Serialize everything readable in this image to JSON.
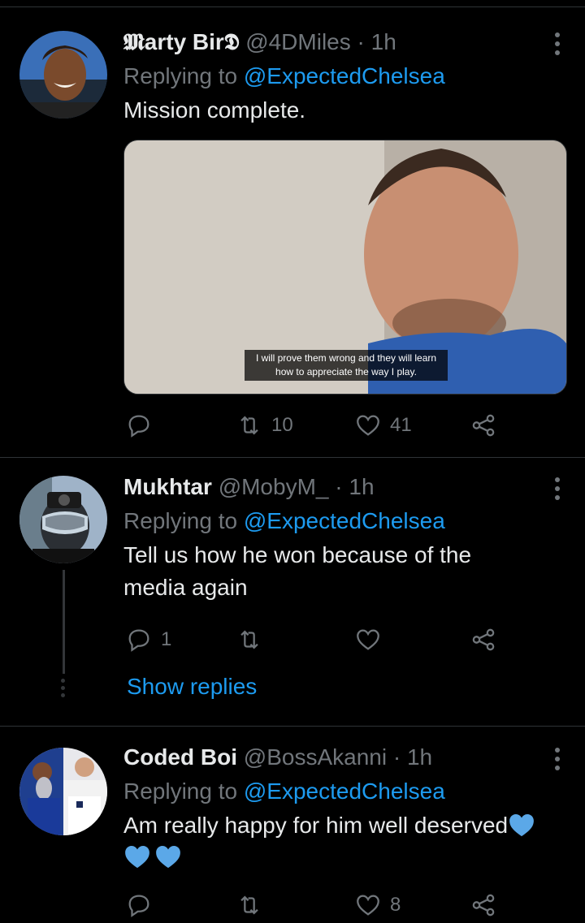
{
  "tweets": [
    {
      "name": "𝕸arty Bir𝕯",
      "handle": "@4DMiles",
      "dot": "·",
      "time": "1h",
      "replying_to_label": "Replying to",
      "replying_to": "@ExpectedChelsea",
      "text": "Mission complete.",
      "media_caption": "I will prove them wrong and they will learn how to appreciate the way I play.",
      "reply_count": "",
      "retweet_count": "10",
      "like_count": "41"
    },
    {
      "name": "Mukhtar",
      "handle": "@MobyM_",
      "dot": "·",
      "time": "1h",
      "replying_to_label": "Replying to",
      "replying_to": "@ExpectedChelsea",
      "text": "Tell us how he won because of the media again",
      "reply_count": "1",
      "retweet_count": "",
      "like_count": "",
      "show_replies": "Show replies"
    },
    {
      "name": "Coded Boi",
      "handle": "@BossAkanni",
      "dot": "·",
      "time": "1h",
      "replying_to_label": "Replying to",
      "replying_to": "@ExpectedChelsea",
      "text": "Am really happy for him well deserved",
      "reply_count": "",
      "retweet_count": "",
      "like_count": "8"
    }
  ],
  "colors": {
    "background": "#000000",
    "accent": "#1d9bf0",
    "muted": "#71767b",
    "heart_emoji": "#5ba8e8"
  },
  "icons": [
    "reply-icon",
    "retweet-icon",
    "like-icon",
    "share-icon",
    "more-icon",
    "blue-heart-emoji"
  ]
}
